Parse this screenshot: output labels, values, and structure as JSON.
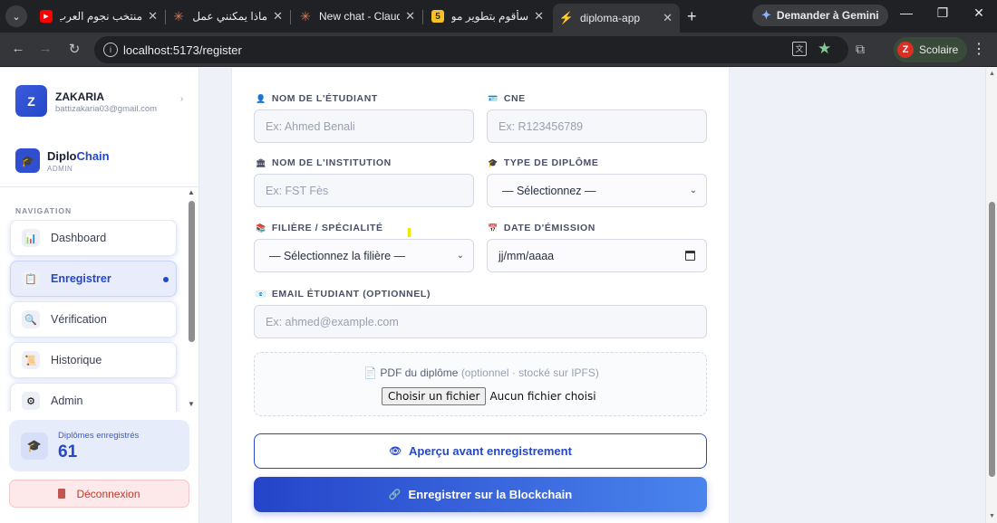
{
  "browser": {
    "tabs": [
      {
        "label": "منتخب نجوم العرب",
        "icon": "youtube-icon",
        "color": "#ff0000",
        "glyph": "▶"
      },
      {
        "label": "ماذا يمكنني عمل يو",
        "icon": "claude-icon",
        "color": "#d97757",
        "glyph": "✳"
      },
      {
        "label": "New chat - Claude",
        "icon": "claude-icon",
        "color": "#d97757",
        "glyph": "✳"
      },
      {
        "label": "سأقوم بتطوير موقا",
        "icon": "app-icon",
        "color": "#f6c026",
        "glyph": "5"
      },
      {
        "label": "diploma-app",
        "icon": "vite-icon",
        "color": "#a259ff",
        "glyph": "⚡"
      }
    ],
    "gemini_label": "Demander à Gemini",
    "url": "localhost:5173/register",
    "profile_label": "Scolaire",
    "profile_initial": "Z",
    "translate_glyph": "文"
  },
  "sidebar": {
    "user": {
      "initial": "Z",
      "name": "ZAKARIA",
      "email": "battizakaria03@gmail.com"
    },
    "brand": {
      "name_part1": "Diplo",
      "name_part2": "Chain",
      "role": "ADMIN"
    },
    "nav_label": "NAVIGATION",
    "nav": [
      {
        "label": "Dashboard",
        "icon": "bar-chart-icon",
        "glyph": "📊",
        "active": false
      },
      {
        "label": "Enregistrer",
        "icon": "clipboard-icon",
        "glyph": "📋",
        "active": true
      },
      {
        "label": "Vérification",
        "icon": "magnifier-icon",
        "glyph": "🔍",
        "active": false
      },
      {
        "label": "Historique",
        "icon": "scroll-icon",
        "glyph": "📜",
        "active": false
      },
      {
        "label": "Admin",
        "icon": "gear-icon",
        "glyph": "⚙",
        "active": false
      }
    ],
    "stat": {
      "label": "Diplômes enregistrés",
      "value": "61"
    },
    "logout_label": "Déconnexion"
  },
  "form": {
    "nom_etudiant": {
      "label": "NOM DE L'ÉTUDIANT",
      "placeholder": "Ex: Ahmed Benali"
    },
    "cne": {
      "label": "CNE",
      "placeholder": "Ex: R123456789"
    },
    "institution": {
      "label": "NOM DE L'INSTITUTION",
      "placeholder": "Ex: FST Fès"
    },
    "type_diplome": {
      "label": "TYPE DE DIPLÔME",
      "value": "— Sélectionnez —"
    },
    "filiere": {
      "label": "FILIÈRE / SPÉCIALITÉ",
      "value": "— Sélectionnez la filière —"
    },
    "date_emission": {
      "label": "DATE D'ÉMISSION",
      "value": "jj/mm/aaaa"
    },
    "email": {
      "label": "EMAIL ÉTUDIANT (OPTIONNEL)",
      "placeholder": "Ex: ahmed@example.com"
    },
    "pdf": {
      "label": "PDF du diplôme",
      "sublabel": "(optionnel · stocké sur IPFS)",
      "button": "Choisir un fichier",
      "status": "Aucun fichier choisi"
    },
    "preview_button": "Aperçu avant enregistrement",
    "register_button": "Enregistrer sur la Blockchain"
  }
}
